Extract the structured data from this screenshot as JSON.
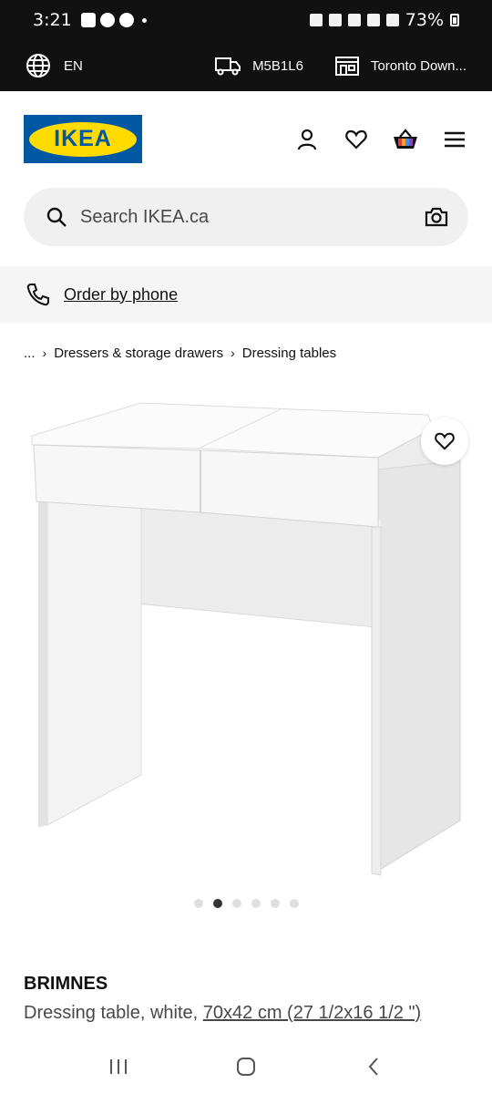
{
  "status_bar": {
    "time": "3:21",
    "battery": "73%"
  },
  "info_bar": {
    "language": "EN",
    "postal_code": "M5B1L6",
    "store": "Toronto Down..."
  },
  "header": {
    "logo_text": "IKEA",
    "brand_blue": "#0058a3",
    "brand_yellow": "#ffdb00"
  },
  "search": {
    "placeholder": "Search IKEA.ca"
  },
  "phone_bar": {
    "link": "Order by phone"
  },
  "breadcrumb": {
    "ellipsis": "...",
    "items": [
      "Dressers & storage drawers",
      "Dressing tables"
    ]
  },
  "carousel": {
    "count": 6,
    "active_index": 1
  },
  "product": {
    "name": "BRIMNES",
    "description": "Dressing table, white, ",
    "dimensions": "70x42 cm (27 1/2x16 1/2 \")"
  }
}
